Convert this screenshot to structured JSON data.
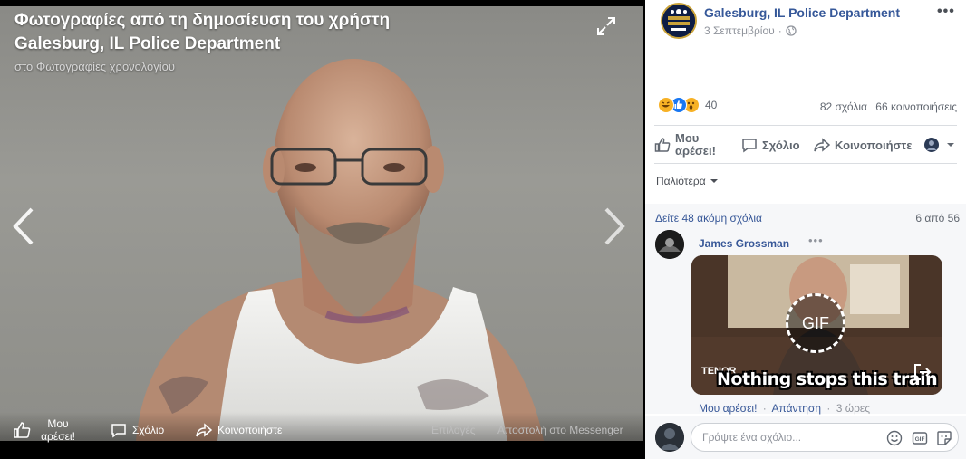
{
  "viewer": {
    "title": "Φωτογραφίες από τη δημοσίευση του χρήστη Galesburg, IL Police Department",
    "subtitle": "στο Φωτογραφίες χρονολογίου",
    "bottom": {
      "like_label": "Μου αρέσει!",
      "comment_label": "Σχόλιο",
      "share_label": "Κοινοποιήστε",
      "options_label": "Επιλογές",
      "messenger_label": "Αποστολή στο Messenger"
    }
  },
  "post": {
    "page_name": "Galesburg, IL Police Department",
    "date": "3 Σεπτεμβρίου",
    "more_label": "•••",
    "reactions_count": "40",
    "comments_count": "82 σχόλια",
    "shares_count": "66 κοινοποιήσεις",
    "actions": {
      "like": "Μου αρέσει!",
      "comment": "Σχόλιο",
      "share": "Κοινοποιήστε"
    },
    "sort_label": "Παλιότερα",
    "more_comments": "Δείτε 48 ακόμη σχόλια",
    "page_counter": "6 από 56"
  },
  "comment": {
    "author": "James Grossman",
    "more_label": "•••",
    "gif_badge": "GIF",
    "gif_source": "TENOR",
    "gif_caption": "Nothing stops this train",
    "like_label": "Μου αρέσει!",
    "reply_label": "Απάντηση",
    "time": "3 ώρες"
  },
  "composer": {
    "placeholder": "Γράψτε ένα σχόλιο..."
  },
  "colors": {
    "link": "#385898",
    "page_name": "#365899",
    "like_blue": "#1877f2",
    "haha_yellow": "#f7b125"
  }
}
